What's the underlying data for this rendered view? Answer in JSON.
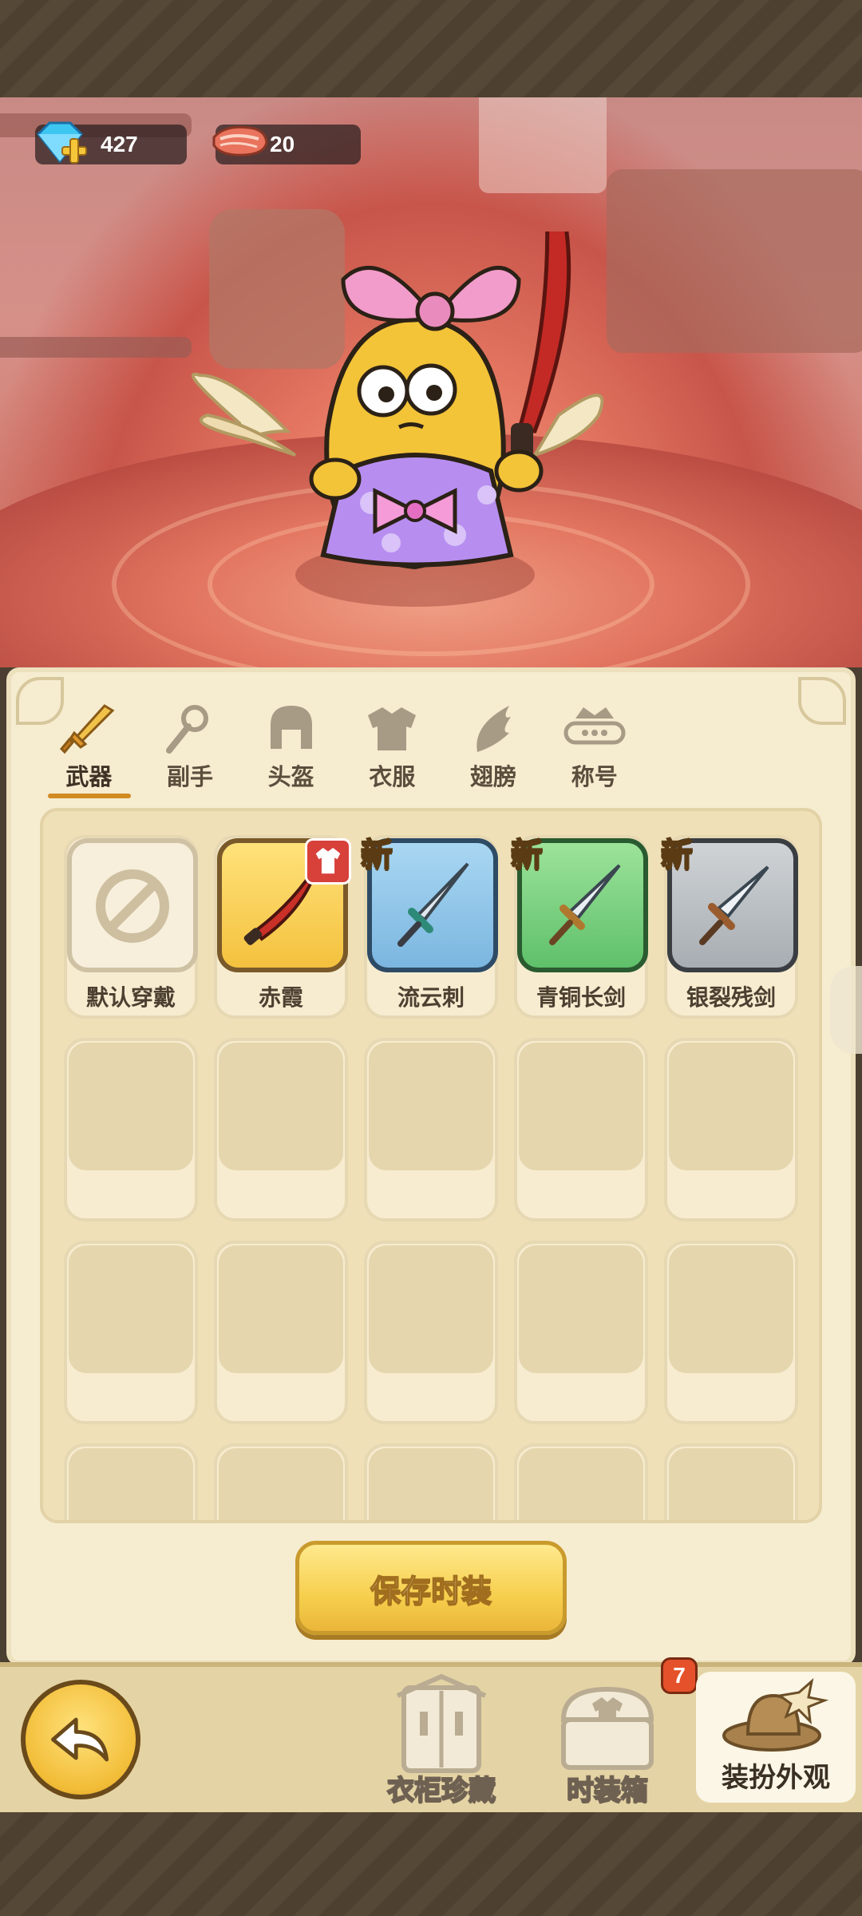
{
  "currencies": [
    {
      "name": "diamond",
      "icon": "diamond-plus-icon",
      "value": "427"
    },
    {
      "name": "meat",
      "icon": "meat-icon",
      "value": "20"
    }
  ],
  "tabs": [
    {
      "label": "武器",
      "icon": "sword-icon",
      "active": true
    },
    {
      "label": "副手",
      "icon": "offhand-icon",
      "active": false
    },
    {
      "label": "头盔",
      "icon": "helmet-icon",
      "active": false
    },
    {
      "label": "衣服",
      "icon": "armor-icon",
      "active": false
    },
    {
      "label": "翅膀",
      "icon": "wing-icon",
      "active": false
    },
    {
      "label": "称号",
      "icon": "title-icon",
      "active": false
    }
  ],
  "items": [
    {
      "name": "默认穿戴",
      "rarity": "default",
      "tag": ""
    },
    {
      "name": "赤霞",
      "rarity": "gold",
      "tag": "equipped-shirt"
    },
    {
      "name": "流云刺",
      "rarity": "blue",
      "tag": "新"
    },
    {
      "name": "青铜长剑",
      "rarity": "green",
      "tag": "新"
    },
    {
      "name": "银裂残剑",
      "rarity": "gray",
      "tag": "新"
    }
  ],
  "save_button": {
    "label": "保存时装"
  },
  "bottom_nav": [
    {
      "label": "衣柜珍藏",
      "icon": "wardrobe-icon",
      "active": false
    },
    {
      "label": "时装箱",
      "icon": "fashion-box-icon",
      "active": false,
      "badge": "7"
    },
    {
      "label": "装扮外观",
      "icon": "hat-icon",
      "active": true
    }
  ],
  "colors": {
    "accent": "#d08b22",
    "panel": "#f6ecd0",
    "button": "#f6cf4d"
  }
}
